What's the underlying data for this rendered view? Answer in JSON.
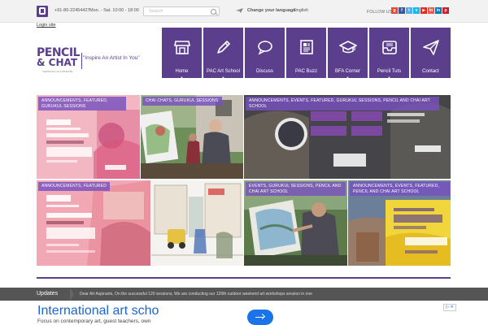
{
  "topbar": {
    "phone": "+91-80-22454427",
    "hours": "Mon. - Sat. 10:00 - 18:00",
    "search_placeholder": "Search",
    "language_label": "Change your language:",
    "language_value": "English",
    "follow_label": "FOLLOW US",
    "social": [
      {
        "label": "g",
        "color": "#dd4b39"
      },
      {
        "label": "f",
        "color": "#3b5998"
      },
      {
        "label": "t",
        "color": "#55acee"
      },
      {
        "label": "v",
        "color": "#1ab7ea"
      },
      {
        "label": "▶",
        "color": "#e52d27"
      },
      {
        "label": "in",
        "color": "#e95950"
      },
      {
        "label": "in",
        "color": "#007bb5"
      },
      {
        "label": "p",
        "color": "#cb2027"
      }
    ]
  },
  "login_link": "Login site",
  "logo": {
    "line1": "PENCIL",
    "line2": "& CHAT",
    "sub": "THROUGH ILLUSTRATE",
    "tagline": "\"Inspire An Artist In You\""
  },
  "nav": [
    {
      "label": "Home",
      "icon": "shop-icon",
      "has_dropdown": true
    },
    {
      "label": "PAC Art School",
      "icon": "pencil-icon",
      "has_dropdown": true
    },
    {
      "label": "Discuss",
      "icon": "speech-bubble-icon",
      "has_dropdown": false
    },
    {
      "label": "PAC Buzz",
      "icon": "newspaper-icon",
      "has_dropdown": false
    },
    {
      "label": "BFA Corner",
      "icon": "graduation-cap-icon",
      "has_dropdown": true
    },
    {
      "label": "Pencil Tuts",
      "icon": "inbox-icon",
      "has_dropdown": true
    },
    {
      "label": "Contact",
      "icon": "paper-plane-icon",
      "has_dropdown": false
    }
  ],
  "tiles": [
    {
      "tag": "ANNOUNCEMENTS, FEATURED, GURUKUL SESSIONS",
      "scene": "poster-pink"
    },
    {
      "tag": "CHAI CHATS, GURUKUL SESSIONS",
      "scene": "street-painting"
    },
    {
      "tag": "ANNOUNCEMENTS, EVENTS, FEATURED, GURUKUL SESSIONS, PENCIL AND CHAI ART SCHOOL",
      "scene": "poster-dark"
    },
    {
      "tag": "ANNOUNCEMENTS, FEATURED",
      "scene": "poster-pink-2"
    },
    {
      "tag": "",
      "scene": "street-sketch"
    },
    {
      "tag": "EVENTS, GURUKUL SESSIONS, PENCIL AND CHAI ART SCHOOL",
      "scene": "easel-painting"
    },
    {
      "tag": "ANNOUNCEMENTS, EVENTS, FEATURED, PENCIL AND CHAI ART SCHOOL",
      "scene": "poster-yellow"
    }
  ],
  "updates": {
    "label": "Updates",
    "text": "Dear Art Aspirants, On the successful 120 sessions, We are conducting our 126th outdoor weekend art workshops session in one"
  },
  "ad": {
    "title": "International art scho",
    "subtitle": "Focus on contemporary art, guest teachers, own",
    "choices": "▷ ✕"
  },
  "colors": {
    "brand_purple": "#5b3f8c",
    "tag_purple": "#7850be",
    "updates_bar": "#555555",
    "ad_blue": "#1a66d3"
  }
}
